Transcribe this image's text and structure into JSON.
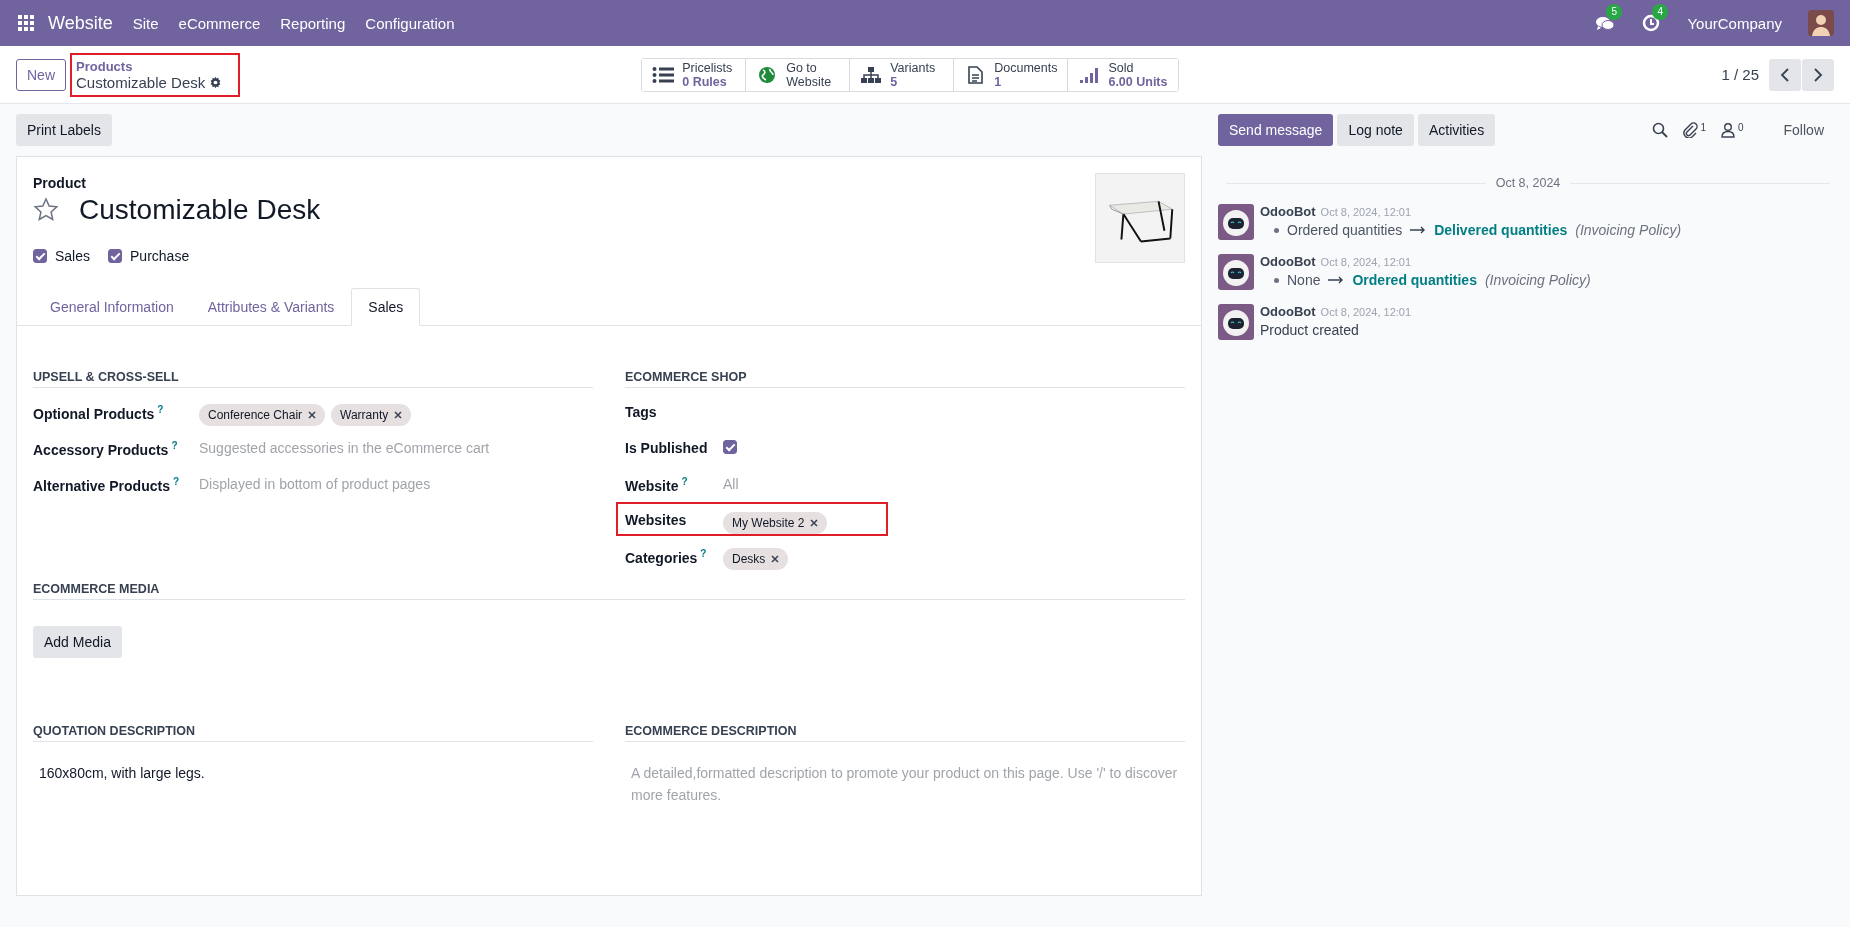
{
  "navbar": {
    "app_name": "Website",
    "menu": [
      "Site",
      "eCommerce",
      "Reporting",
      "Configuration"
    ],
    "messages_count": "5",
    "activities_count": "4",
    "company": "YourCompany"
  },
  "control_panel": {
    "new_button": "New",
    "breadcrumb": {
      "parent": "Products",
      "current": "Customizable Desk",
      "highlighted": true
    },
    "smart_buttons": [
      {
        "kind": "list",
        "label": "Pricelists",
        "value": "0 Rules"
      },
      {
        "kind": "globe",
        "label": "Go to",
        "value": "Website"
      },
      {
        "kind": "tree",
        "label": "Variants",
        "value": "5"
      },
      {
        "kind": "document",
        "label": "Documents",
        "value": "1"
      },
      {
        "kind": "bars",
        "label": "Sold",
        "value": "6.00 Units"
      }
    ],
    "pager": "1 / 25"
  },
  "action_buttons": [
    "Print Labels"
  ],
  "form": {
    "type_label": "Product",
    "name": "Customizable Desk",
    "favorite": false,
    "checkboxes": [
      {
        "label": "Sales",
        "checked": true
      },
      {
        "label": "Purchase",
        "checked": true
      }
    ],
    "tabs": [
      {
        "label": "General Information",
        "selected": false
      },
      {
        "label": "Attributes & Variants",
        "selected": false
      },
      {
        "label": "Sales",
        "selected": true
      }
    ],
    "groups": [
      {
        "title": "UPSELL & CROSS-SELL",
        "fields": [
          {
            "label": "Optional Products",
            "help": "?",
            "kind": "tags",
            "tags": [
              "Conference Chair",
              "Warranty"
            ]
          },
          {
            "label": "Accessory Products",
            "help": "?",
            "kind": "placeholder",
            "placeholder": "Suggested accessories in the eCommerce cart"
          },
          {
            "label": "Alternative Products",
            "help": "?",
            "kind": "placeholder",
            "placeholder": "Displayed in bottom of product pages"
          }
        ]
      },
      {
        "title": "ECOMMERCE SHOP",
        "fields": [
          {
            "label": "Tags",
            "kind": "empty"
          },
          {
            "label": "Is Published",
            "kind": "checkbox",
            "checked": true
          },
          {
            "label": "Website",
            "help": "?",
            "kind": "placeholder",
            "placeholder": "All"
          },
          {
            "label": "Websites",
            "kind": "tags",
            "tags": [
              "My Website 2"
            ],
            "highlighted": true
          },
          {
            "label": "Categories",
            "help": "?",
            "kind": "tags",
            "tags": [
              "Desks"
            ]
          }
        ]
      },
      {
        "title": "ECOMMERCE MEDIA",
        "wide": true,
        "button": "Add Media"
      },
      {
        "title": "QUOTATION DESCRIPTION",
        "text": "160x80cm, with large legs."
      },
      {
        "title": "ECOMMERCE DESCRIPTION",
        "placeholder": "A detailed,formatted description to promote your product on this page. Use '/' to discover more features."
      }
    ]
  },
  "chatter": {
    "buttons": [
      {
        "label": "Send message",
        "selected": true
      },
      {
        "label": "Log note",
        "selected": false
      },
      {
        "label": "Activities",
        "selected": false
      }
    ],
    "attachments_count": "1",
    "followers_count": "0",
    "follow": "Follow",
    "date_separator": "Oct 8, 2024",
    "messages": [
      {
        "author": "OdooBot",
        "date": "Oct 8, 2024, 12:01",
        "kind": "tracking",
        "old": "Ordered quantities",
        "new": "Delivered quantities",
        "field": "(Invoicing Policy)"
      },
      {
        "author": "OdooBot",
        "date": "Oct 8, 2024, 12:01",
        "kind": "tracking",
        "old": "None",
        "new": "Ordered quantities",
        "field": "(Invoicing Policy)"
      },
      {
        "author": "OdooBot",
        "date": "Oct 8, 2024, 12:01",
        "kind": "text",
        "body": "Product created"
      }
    ]
  }
}
